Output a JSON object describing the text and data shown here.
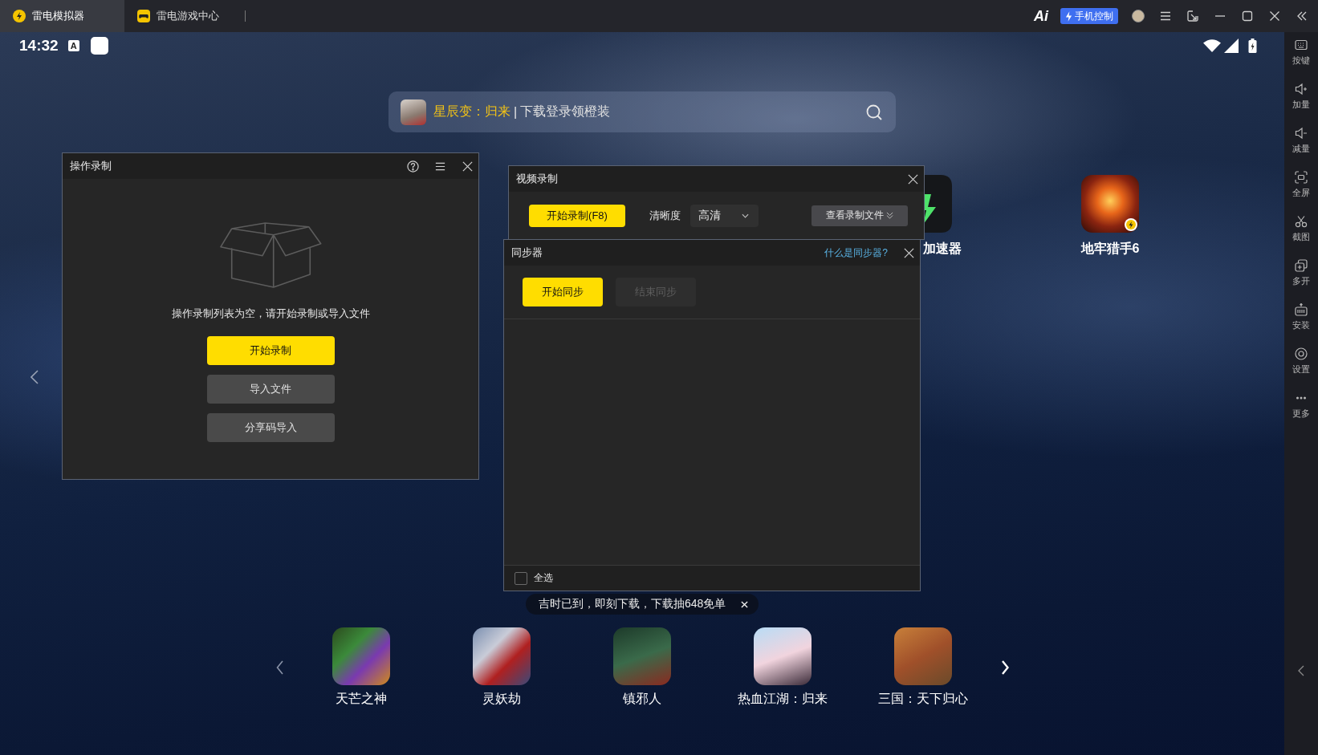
{
  "window": {
    "tabs": [
      {
        "label": "雷电模拟器",
        "selected": true
      },
      {
        "label": "雷电游戏中心",
        "selected": false
      }
    ],
    "ai_button": "Ai",
    "phone_control_button": "手机控制"
  },
  "status_bar": {
    "time": "14:32",
    "notification": "A"
  },
  "search_bar": {
    "game": "星辰变：归来",
    "separator": "|",
    "promo": "下载登录领橙装"
  },
  "desktop_apps": [
    {
      "label": "加速器"
    },
    {
      "label": "地牢猎手6"
    }
  ],
  "operation_recording": {
    "title": "操作录制",
    "empty_message": "操作录制列表为空，请开始录制或导入文件",
    "buttons": [
      {
        "label": "开始录制",
        "kind": "primary"
      },
      {
        "label": "导入文件",
        "kind": "secondary"
      },
      {
        "label": "分享码导入",
        "kind": "secondary"
      }
    ]
  },
  "video_recording": {
    "title": "视频录制",
    "start_button": "开始录制(F8)",
    "quality_label": "清晰度",
    "quality_value": "高清",
    "files_button": "查看录制文件"
  },
  "synchronizer": {
    "title": "同步器",
    "help_link": "什么是同步器?",
    "buttons": [
      {
        "label": "开始同步",
        "kind": "primary",
        "disabled": false
      },
      {
        "label": "结束同步",
        "kind": "secondary",
        "disabled": true
      }
    ],
    "select_all": {
      "label": "全选",
      "checked": false
    }
  },
  "toast": {
    "text": "吉时已到，即刻下载，下载抽648免单"
  },
  "dock": {
    "apps": [
      {
        "label": "天芒之神"
      },
      {
        "label": "灵妖劫"
      },
      {
        "label": "镇邪人"
      },
      {
        "label": "热血江湖：归来"
      },
      {
        "label": "三国：天下归心"
      }
    ]
  },
  "sidebar": {
    "items": [
      {
        "label": "按键"
      },
      {
        "label": "加量"
      },
      {
        "label": "减量"
      },
      {
        "label": "全屏"
      },
      {
        "label": "截图"
      },
      {
        "label": "多开"
      },
      {
        "label": "安装"
      },
      {
        "label": "设置"
      },
      {
        "label": "更多"
      }
    ]
  }
}
